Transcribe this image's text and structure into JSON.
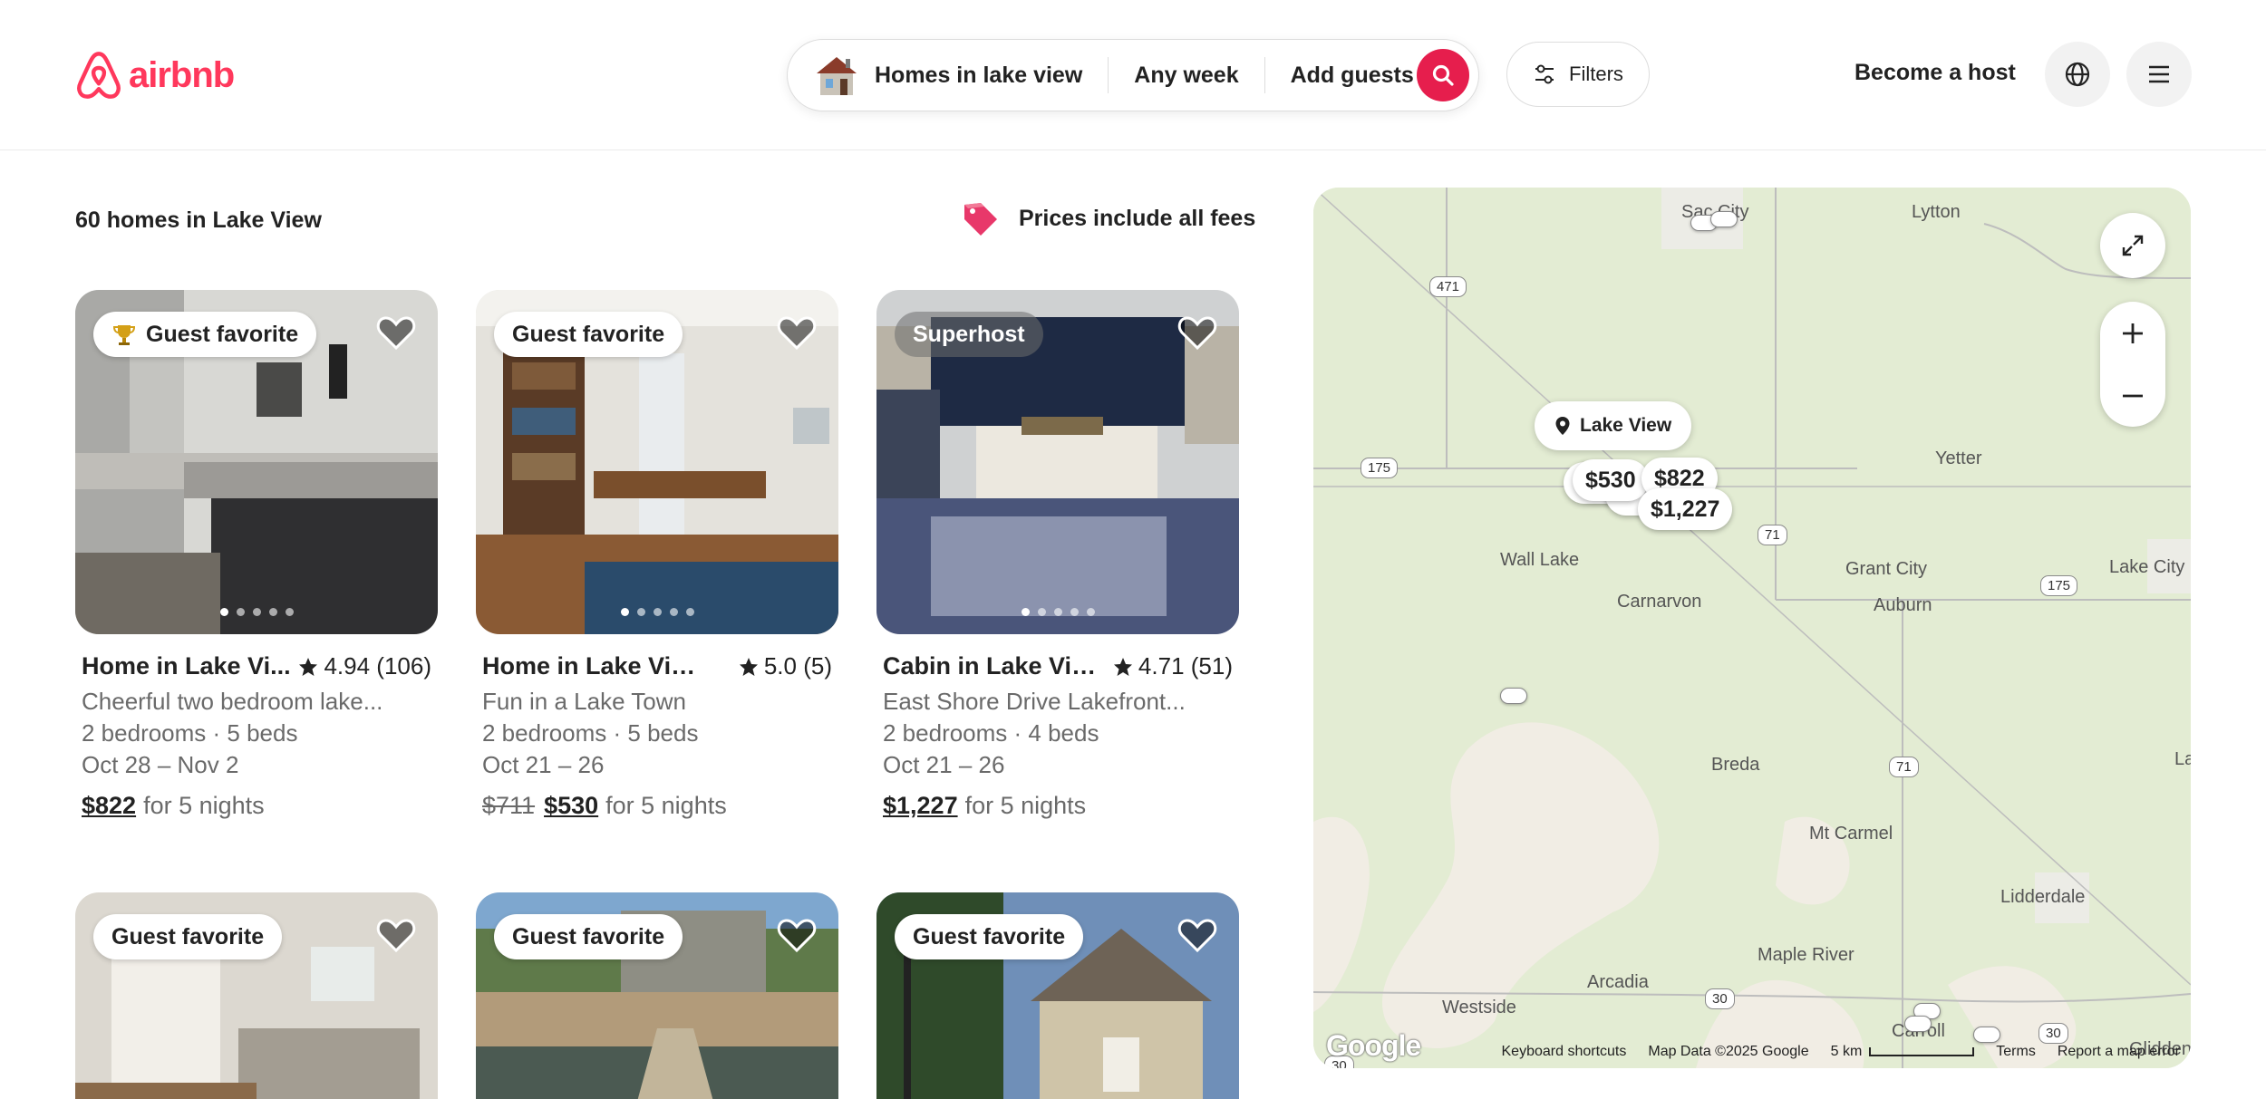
{
  "header": {
    "logo_text": "airbnb",
    "brand_color": "#ff385c",
    "search": {
      "location": "Homes in lake view",
      "dates": "Any week",
      "guests": "Add guests",
      "button_color": "#e61e4d"
    },
    "filters_label": "Filters",
    "host_label": "Become a host",
    "icons": [
      "airbnb-logo-icon",
      "home-icon",
      "search-icon",
      "filters-icon",
      "globe-icon",
      "menu-icon"
    ]
  },
  "results": {
    "count_label": "60 homes in Lake View",
    "prices_note": "Prices include all fees"
  },
  "listings": [
    {
      "badge": "Guest favorite",
      "badge_icon": "trophy-icon",
      "title": "Home in Lake Vi...",
      "rating": "4.94 (106)",
      "desc": "Cheerful two bedroom lake...",
      "beds": "2 bedrooms · 5 beds",
      "dates": "Oct 28 – Nov 2",
      "original_price": "",
      "price": "$822",
      "price_suffix": "for 5 nights"
    },
    {
      "badge": "Guest favorite",
      "badge_icon": "",
      "title": "Home in Lake View",
      "rating": "5.0 (5)",
      "desc": "Fun in a Lake Town",
      "beds": "2 bedrooms · 5 beds",
      "dates": "Oct 21 – 26",
      "original_price": "$711",
      "price": "$530",
      "price_suffix": "for 5 nights"
    },
    {
      "badge": "Superhost",
      "badge_icon": "",
      "title": "Cabin in Lake View",
      "rating": "4.71 (51)",
      "desc": "East Shore Drive Lakefront...",
      "beds": "2 bedrooms · 4 beds",
      "dates": "Oct 21 – 26",
      "original_price": "",
      "price": "$1,227",
      "price_suffix": "for 5 nights"
    },
    {
      "badge": "Guest favorite"
    },
    {
      "badge": "Guest favorite"
    },
    {
      "badge": "Guest favorite"
    }
  ],
  "map": {
    "selected_place": "Lake View",
    "price_pins": [
      "$530",
      "$822",
      "$1,227"
    ],
    "places": [
      "Sac City",
      "Lytton",
      "Wall Lake",
      "Carnarvon",
      "Yetter",
      "Grant City",
      "Auburn",
      "Lake City",
      "Breda",
      "Mt Carmel",
      "Lidderdale",
      "Maple River",
      "Arcadia",
      "Westside",
      "Carroll",
      "Glidden",
      "La"
    ],
    "routes": [
      "471",
      "175",
      "71",
      "175",
      "71",
      "30",
      "30",
      "30"
    ],
    "footer": {
      "google": "Google",
      "shortcuts": "Keyboard shortcuts",
      "data": "Map Data ©2025 Google",
      "scale": "5 km",
      "terms": "Terms",
      "report": "Report a map error"
    }
  }
}
